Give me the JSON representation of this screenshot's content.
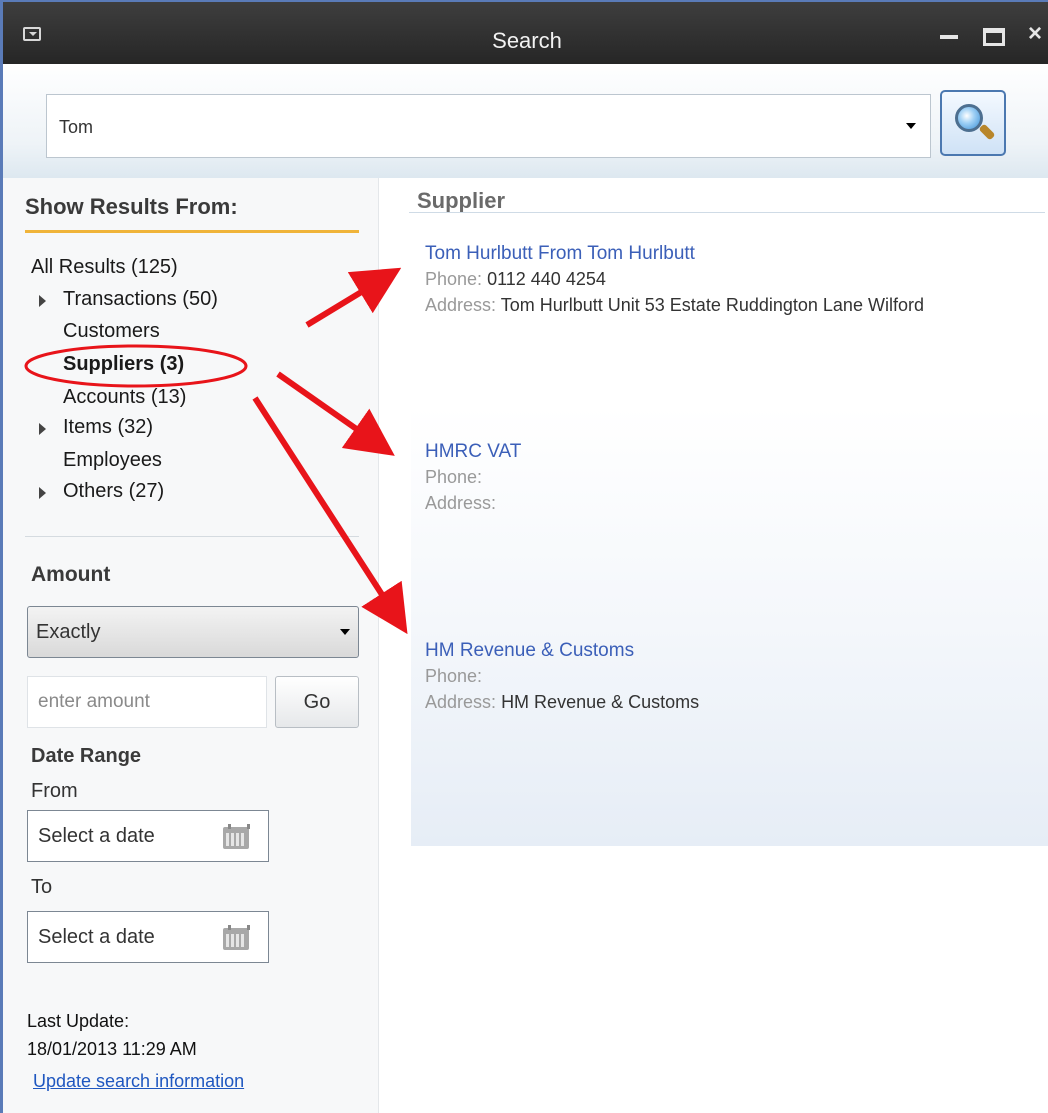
{
  "window": {
    "title": "Search"
  },
  "search": {
    "query": "Tom"
  },
  "filters": {
    "header": "Show Results From:",
    "items": [
      {
        "label": "All Results (125)",
        "expandable": false,
        "selected": false
      },
      {
        "label": "Transactions (50)",
        "expandable": true,
        "selected": false
      },
      {
        "label": "Customers",
        "expandable": false,
        "selected": false
      },
      {
        "label": "Suppliers (3)",
        "expandable": false,
        "selected": true
      },
      {
        "label": "Accounts (13)",
        "expandable": false,
        "selected": false
      },
      {
        "label": "Items (32)",
        "expandable": true,
        "selected": false
      },
      {
        "label": "Employees",
        "expandable": false,
        "selected": false
      },
      {
        "label": "Others (27)",
        "expandable": true,
        "selected": false
      }
    ],
    "amount_label": "Amount",
    "amount_mode": "Exactly",
    "amount_placeholder": "enter amount",
    "go_label": "Go",
    "date_range_label": "Date Range",
    "from_label": "From",
    "to_label": "To",
    "from_placeholder": "Select a date",
    "to_placeholder": "Select a date",
    "last_update_label": "Last Update:",
    "last_update_value": "18/01/2013 11:29 AM",
    "update_link": "Update search information"
  },
  "results": {
    "category": "Supplier",
    "phone_label": "Phone:",
    "address_label": "Address:",
    "items": [
      {
        "name": "Tom Hurlbutt  From  Tom Hurlbutt",
        "phone": "0112 440 4254",
        "address": "Tom Hurlbutt Unit 53 Estate Ruddington Lane Wilford"
      },
      {
        "name": "HMRC VAT",
        "phone": "",
        "address": ""
      },
      {
        "name": "HM Revenue & Customs",
        "phone": "",
        "address": "HM Revenue & Customs"
      }
    ]
  },
  "colors": {
    "accent_underline": "#f0b43a",
    "link": "#3b5fb8",
    "annotation": "#e8141a"
  }
}
